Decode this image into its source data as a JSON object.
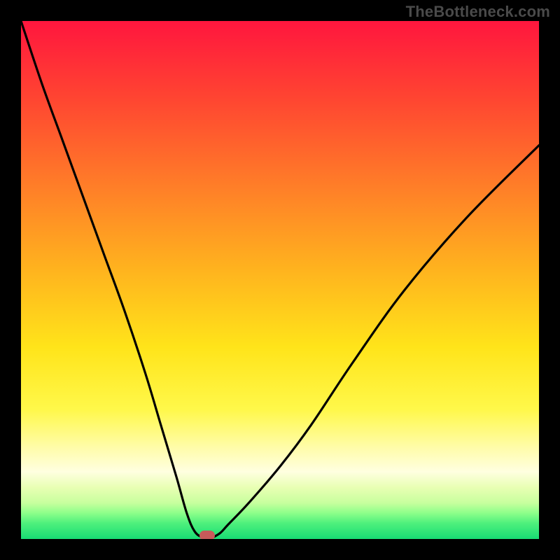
{
  "watermark": "TheBottleneck.com",
  "colors": {
    "page_bg": "#000000",
    "watermark_text": "#4a4a4a",
    "curve_stroke": "#000000",
    "marker_fill": "#c85a5a",
    "gradient_top": "#ff163e",
    "gradient_bottom": "#18dc74"
  },
  "chart_data": {
    "type": "line",
    "title": "",
    "xlabel": "",
    "ylabel": "",
    "x_range": [
      0,
      100
    ],
    "y_range": [
      0,
      100
    ],
    "description": "V-shaped bottleneck curve over a red-to-green vertical gradient. The curve reaches its minimum near x≈36 where a rounded marker sits at the bottom.",
    "series": [
      {
        "name": "bottleneck-curve",
        "x": [
          0,
          4,
          8,
          12,
          16,
          20,
          24,
          27,
          30,
          32,
          33.5,
          35,
          36,
          37,
          38.5,
          40,
          44,
          50,
          56,
          64,
          74,
          86,
          100
        ],
        "y": [
          100,
          88,
          77,
          66,
          55,
          44,
          32,
          22,
          12,
          5,
          1.5,
          0.3,
          0,
          0.3,
          1.2,
          2.8,
          7,
          14,
          22,
          34,
          48,
          62,
          76
        ]
      }
    ],
    "marker": {
      "x": 36,
      "y": 0,
      "label": "optimal-point"
    },
    "grid": false,
    "legend": false
  }
}
